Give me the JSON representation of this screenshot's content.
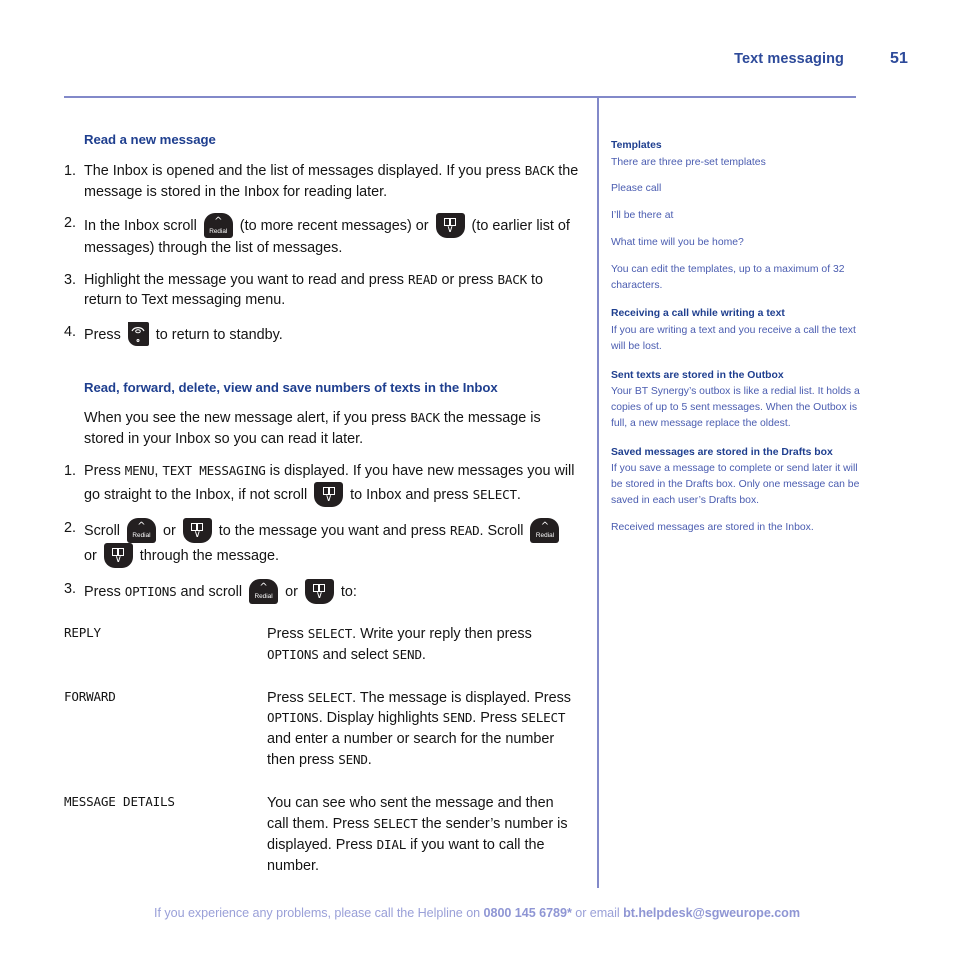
{
  "header": {
    "section_title": "Text messaging",
    "page_number": "51"
  },
  "main": {
    "section1": {
      "heading": "Read a new message",
      "steps": [
        {
          "num": "1.",
          "parts": [
            {
              "t": "text",
              "v": "The Inbox is opened and the list of messages displayed. If you press "
            },
            {
              "t": "cmd",
              "v": "BACK"
            },
            {
              "t": "text",
              "v": " the message is stored in the Inbox for reading later."
            }
          ]
        },
        {
          "num": "2.",
          "parts": [
            {
              "t": "text",
              "v": "In the Inbox scroll "
            },
            {
              "t": "key-up",
              "v": "Redial"
            },
            {
              "t": "text",
              "v": " (to more recent messages) or "
            },
            {
              "t": "key-down",
              "v": ""
            },
            {
              "t": "text",
              "v": " (to earlier list of messages) through the list of messages."
            }
          ]
        },
        {
          "num": "3.",
          "parts": [
            {
              "t": "text",
              "v": "Highlight the message you want to read and press "
            },
            {
              "t": "cmd",
              "v": "READ"
            },
            {
              "t": "text",
              "v": " or press "
            },
            {
              "t": "cmd",
              "v": "BACK"
            },
            {
              "t": "text",
              "v": " to return to Text messaging menu."
            }
          ]
        },
        {
          "num": "4.",
          "parts": [
            {
              "t": "text",
              "v": "Press "
            },
            {
              "t": "key-standby",
              "v": ""
            },
            {
              "t": "text",
              "v": " to return to standby."
            }
          ]
        }
      ]
    },
    "section2": {
      "heading": "Read, forward, delete, view and save numbers of texts in the Inbox",
      "intro": [
        {
          "t": "text",
          "v": "When you see the new message alert, if you press "
        },
        {
          "t": "cmd",
          "v": "BACK"
        },
        {
          "t": "text",
          "v": " the message is stored in your Inbox so you can read it later."
        }
      ],
      "steps": [
        {
          "num": "1.",
          "parts": [
            {
              "t": "text",
              "v": "Press "
            },
            {
              "t": "cmd",
              "v": "MENU"
            },
            {
              "t": "text",
              "v": ", "
            },
            {
              "t": "cmd",
              "v": "TEXT MESSAGING"
            },
            {
              "t": "text",
              "v": " is displayed. If you have new messages you will go straight to the Inbox, if not scroll "
            },
            {
              "t": "key-down",
              "v": ""
            },
            {
              "t": "text",
              "v": " to Inbox and press "
            },
            {
              "t": "cmd",
              "v": "SELECT"
            },
            {
              "t": "text",
              "v": "."
            }
          ]
        },
        {
          "num": "2.",
          "parts": [
            {
              "t": "text",
              "v": "Scroll "
            },
            {
              "t": "key-up",
              "v": "Redial"
            },
            {
              "t": "text",
              "v": " or "
            },
            {
              "t": "key-down",
              "v": ""
            },
            {
              "t": "text",
              "v": " to the message you want and press "
            },
            {
              "t": "cmd",
              "v": "READ"
            },
            {
              "t": "text",
              "v": ". Scroll "
            },
            {
              "t": "key-up",
              "v": "Redial"
            },
            {
              "t": "text",
              "v": " or "
            },
            {
              "t": "key-down",
              "v": ""
            },
            {
              "t": "text",
              "v": " through the message."
            }
          ]
        },
        {
          "num": "3.",
          "parts": [
            {
              "t": "text",
              "v": "Press "
            },
            {
              "t": "cmd",
              "v": "OPTIONS"
            },
            {
              "t": "text",
              "v": " and scroll "
            },
            {
              "t": "key-up",
              "v": "Redial"
            },
            {
              "t": "text",
              "v": " or "
            },
            {
              "t": "key-down",
              "v": ""
            },
            {
              "t": "text",
              "v": " to:"
            }
          ]
        }
      ]
    },
    "definitions": [
      {
        "term": "REPLY",
        "desc": [
          {
            "t": "text",
            "v": "Press "
          },
          {
            "t": "cmd",
            "v": "SELECT"
          },
          {
            "t": "text",
            "v": ". Write your reply then press "
          },
          {
            "t": "cmd",
            "v": "OPTIONS"
          },
          {
            "t": "text",
            "v": " and select "
          },
          {
            "t": "cmd",
            "v": "SEND"
          },
          {
            "t": "text",
            "v": "."
          }
        ]
      },
      {
        "term": "FORWARD",
        "desc": [
          {
            "t": "text",
            "v": "Press "
          },
          {
            "t": "cmd",
            "v": "SELECT"
          },
          {
            "t": "text",
            "v": ". The message is displayed. Press "
          },
          {
            "t": "cmd",
            "v": "OPTIONS"
          },
          {
            "t": "text",
            "v": ". Display highlights "
          },
          {
            "t": "cmd",
            "v": "SEND"
          },
          {
            "t": "text",
            "v": ". Press "
          },
          {
            "t": "cmd",
            "v": "SELECT"
          },
          {
            "t": "text",
            "v": " and enter a number or search for the number then press "
          },
          {
            "t": "cmd",
            "v": "SEND"
          },
          {
            "t": "text",
            "v": "."
          }
        ]
      },
      {
        "term": "MESSAGE DETAILS",
        "desc": [
          {
            "t": "text",
            "v": "You can see who sent the message and then call them. Press "
          },
          {
            "t": "cmd",
            "v": "SELECT"
          },
          {
            "t": "text",
            "v": " the sender’s number is displayed. Press "
          },
          {
            "t": "cmd",
            "v": "DIAL"
          },
          {
            "t": "text",
            "v": " if you want to call the number."
          }
        ]
      }
    ]
  },
  "sidebar": [
    {
      "heading": "Templates",
      "paragraphs": [
        "There are three pre-set templates",
        "Please call",
        "I’ll be there at",
        "What time will you be home?",
        "You can edit the templates, up to a maximum of 32 characters."
      ]
    },
    {
      "heading": "Receiving a call while writing a text",
      "paragraphs": [
        "If you are writing a text and you receive a call the text will be lost."
      ]
    },
    {
      "heading": "Sent texts are stored in the Outbox",
      "paragraphs": [
        "Your BT Synergy’s outbox is like a redial list. It holds a copies of up to 5 sent messages. When the Outbox is full, a new message replace the oldest."
      ]
    },
    {
      "heading": "Saved messages are stored in the Drafts box",
      "paragraphs": [
        "If you save a message to complete or send later it will be stored in the Drafts box. Only one message can be saved in each user’s Drafts box.",
        "Received messages are stored in the Inbox."
      ]
    }
  ],
  "footer": {
    "lead": "If you experience any problems, please call the Helpline on ",
    "phone": "0800 145 6789*",
    "middle": " or email ",
    "email": "bt.helpdesk@sgweurope.com"
  },
  "colors": {
    "heading_blue": "#1f3f8f",
    "rule_blue": "#8289c9",
    "sidebar_blue": "#4a5cb0",
    "footer_purple": "#9aa0d8",
    "key_dark": "#231f20"
  }
}
